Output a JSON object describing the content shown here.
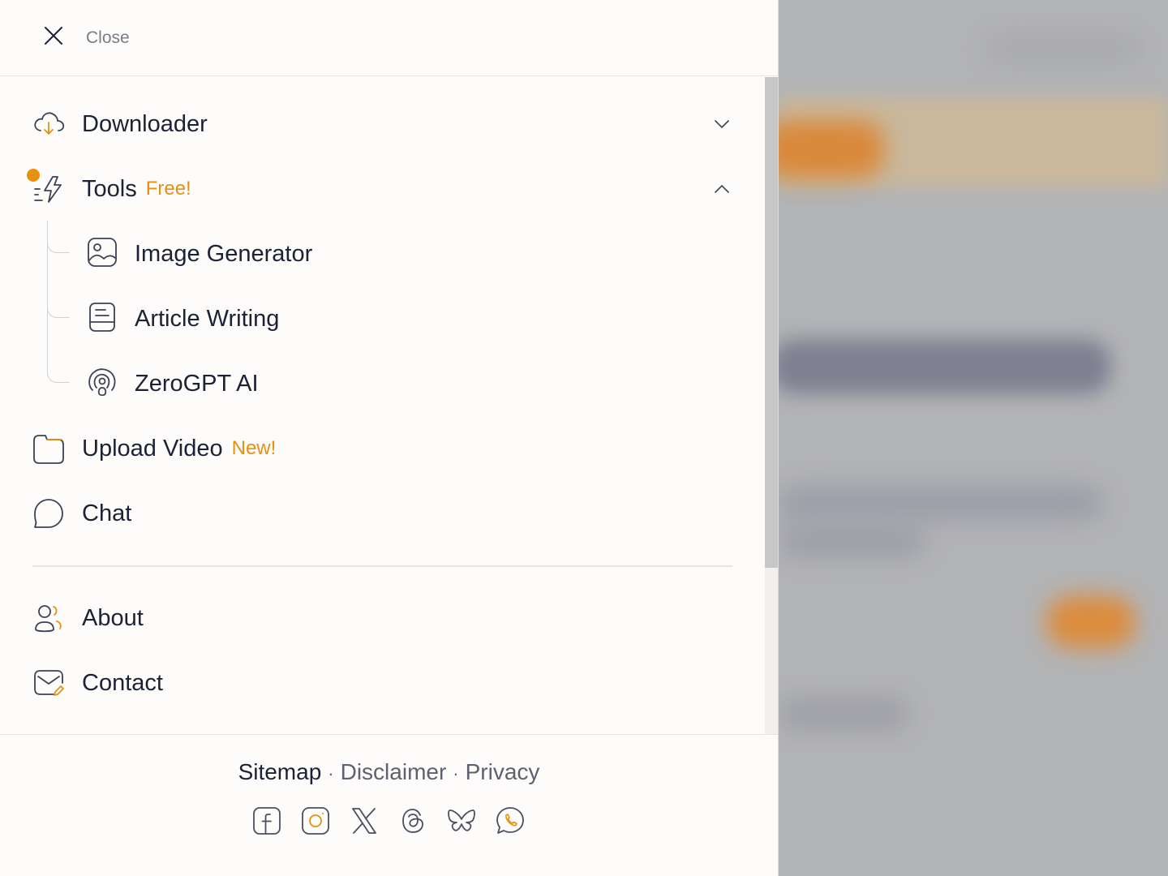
{
  "header": {
    "close_label": "Close"
  },
  "menu": {
    "downloader": {
      "label": "Downloader"
    },
    "tools": {
      "label": "Tools",
      "badge": "Free!"
    },
    "tool_items": [
      {
        "label": "Image Generator",
        "icon": "image-icon"
      },
      {
        "label": "Article Writing",
        "icon": "document-icon"
      },
      {
        "label": "ZeroGPT AI",
        "icon": "fingerprint-icon"
      }
    ],
    "upload": {
      "label": "Upload Video",
      "badge": "New!"
    },
    "chat": {
      "label": "Chat"
    },
    "about": {
      "label": "About"
    },
    "contact": {
      "label": "Contact"
    }
  },
  "footer": {
    "links": [
      "Sitemap",
      "Disclaimer",
      "Privacy"
    ],
    "separator": "·",
    "social": [
      "facebook-icon",
      "instagram-icon",
      "x-icon",
      "threads-icon",
      "bluesky-icon",
      "whatsapp-icon"
    ]
  },
  "colors": {
    "accent": "#e8900f",
    "text": "#1c2236",
    "icon": "#3b4254"
  }
}
